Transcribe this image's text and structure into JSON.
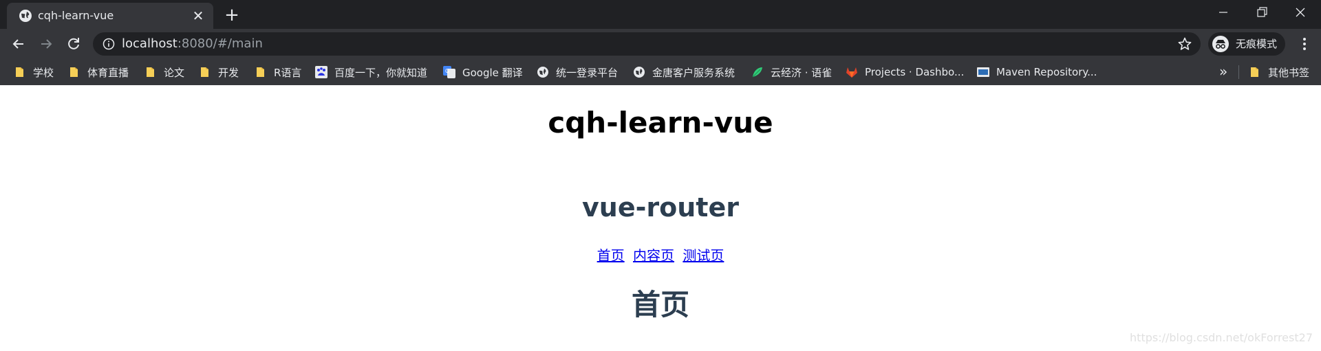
{
  "tab": {
    "title": "cqh-learn-vue",
    "close": "✕",
    "new_tab": "+"
  },
  "toolbar": {
    "url_host": "localhost",
    "url_rest": ":8080/#/main",
    "incognito_label": "无痕模式"
  },
  "bookmarks": [
    {
      "label": "学校",
      "icon": "folder"
    },
    {
      "label": "体育直播",
      "icon": "folder"
    },
    {
      "label": "论文",
      "icon": "folder"
    },
    {
      "label": "开发",
      "icon": "folder"
    },
    {
      "label": "R语言",
      "icon": "folder"
    },
    {
      "label": "百度一下，你就知道",
      "icon": "baidu"
    },
    {
      "label": "Google 翻译",
      "icon": "google-translate"
    },
    {
      "label": "统一登录平台",
      "icon": "globe"
    },
    {
      "label": "金唐客户服务系统",
      "icon": "globe"
    },
    {
      "label": "云经济 · 语雀",
      "icon": "yuque"
    },
    {
      "label": "Projects · Dashbo...",
      "icon": "gitlab"
    },
    {
      "label": "Maven Repository...",
      "icon": "maven"
    }
  ],
  "bookmarks_more": "»",
  "other_bookmarks": "其他书签",
  "page": {
    "app_title": "cqh-learn-vue",
    "router_title": "vue-router",
    "links": [
      "首页",
      "内容页",
      "测试页"
    ],
    "view_title": "首页",
    "watermark": "https://blog.csdn.net/okForrest27"
  },
  "colors": {
    "tab_bg": "#202124",
    "toolbar_bg": "#35363a",
    "heading_color": "#2c3e50",
    "link_color": "#0000ee"
  }
}
